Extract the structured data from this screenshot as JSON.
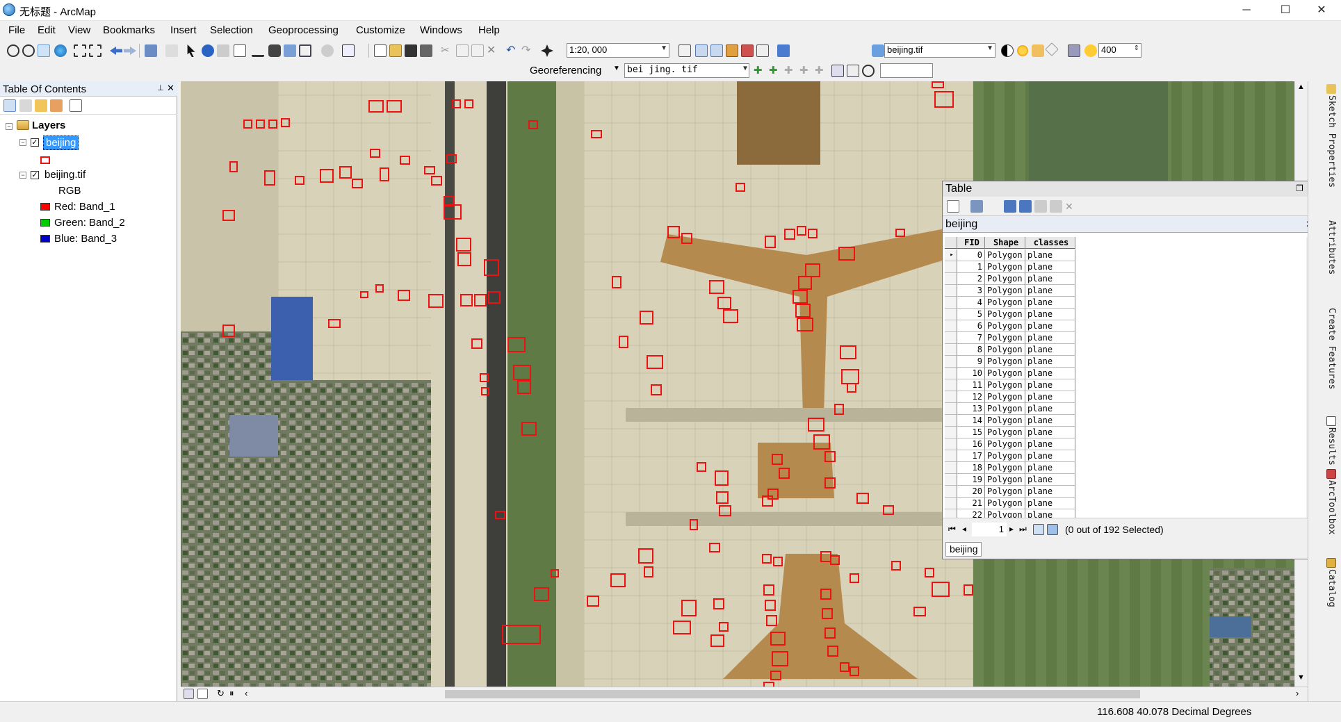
{
  "window": {
    "title": "无标题 - ArcMap",
    "minimize": "─",
    "maximize": "☐",
    "close": "✕"
  },
  "menu": [
    "File",
    "Edit",
    "View",
    "Bookmarks",
    "Insert",
    "Selection",
    "Geoprocessing",
    "Customize",
    "Windows",
    "Help"
  ],
  "toolbar": {
    "scale": "1:20, 000",
    "layer_combo": "beijing.tif",
    "spin_value": "400"
  },
  "georef": {
    "label": "Georeferencing",
    "layer": "bei jing. tif"
  },
  "toc": {
    "title": "Table Of Contents",
    "layers_label": "Layers",
    "layer1": "beijing",
    "layer2": "beijing.tif",
    "rgb": "RGB",
    "red": "Red:     Band_1",
    "green": "Green:  Band_2",
    "blue": "Blue:    Band_3"
  },
  "colors": {
    "red_band": "#ff0000",
    "green_band": "#00cc00",
    "blue_band": "#0000cc",
    "selection": "#3399ff",
    "detection_box": "#ee1111"
  },
  "table": {
    "title": "Table",
    "layer": "beijing",
    "columns": [
      "FID",
      "Shape",
      "classes"
    ],
    "rows": [
      [
        "0",
        "Polygon",
        "plane"
      ],
      [
        "1",
        "Polygon",
        "plane"
      ],
      [
        "2",
        "Polygon",
        "plane"
      ],
      [
        "3",
        "Polygon",
        "plane"
      ],
      [
        "4",
        "Polygon",
        "plane"
      ],
      [
        "5",
        "Polygon",
        "plane"
      ],
      [
        "6",
        "Polygon",
        "plane"
      ],
      [
        "7",
        "Polygon",
        "plane"
      ],
      [
        "8",
        "Polygon",
        "plane"
      ],
      [
        "9",
        "Polygon",
        "plane"
      ],
      [
        "10",
        "Polygon",
        "plane"
      ],
      [
        "11",
        "Polygon",
        "plane"
      ],
      [
        "12",
        "Polygon",
        "plane"
      ],
      [
        "13",
        "Polygon",
        "plane"
      ],
      [
        "14",
        "Polygon",
        "plane"
      ],
      [
        "15",
        "Polygon",
        "plane"
      ],
      [
        "16",
        "Polygon",
        "plane"
      ],
      [
        "17",
        "Polygon",
        "plane"
      ],
      [
        "18",
        "Polygon",
        "plane"
      ],
      [
        "19",
        "Polygon",
        "plane"
      ],
      [
        "20",
        "Polygon",
        "plane"
      ],
      [
        "21",
        "Polygon",
        "plane"
      ],
      [
        "22",
        "Polygon",
        "plane"
      ]
    ],
    "record": "1",
    "selected": "(0 out of 192 Selected)",
    "tab": "beijing"
  },
  "dock_tabs": [
    "Sketch Properties",
    "Attributes",
    "Create Features",
    "Results",
    "ArcToolbox",
    "Catalog"
  ],
  "coords": "116.608  40.078 Decimal Degrees"
}
